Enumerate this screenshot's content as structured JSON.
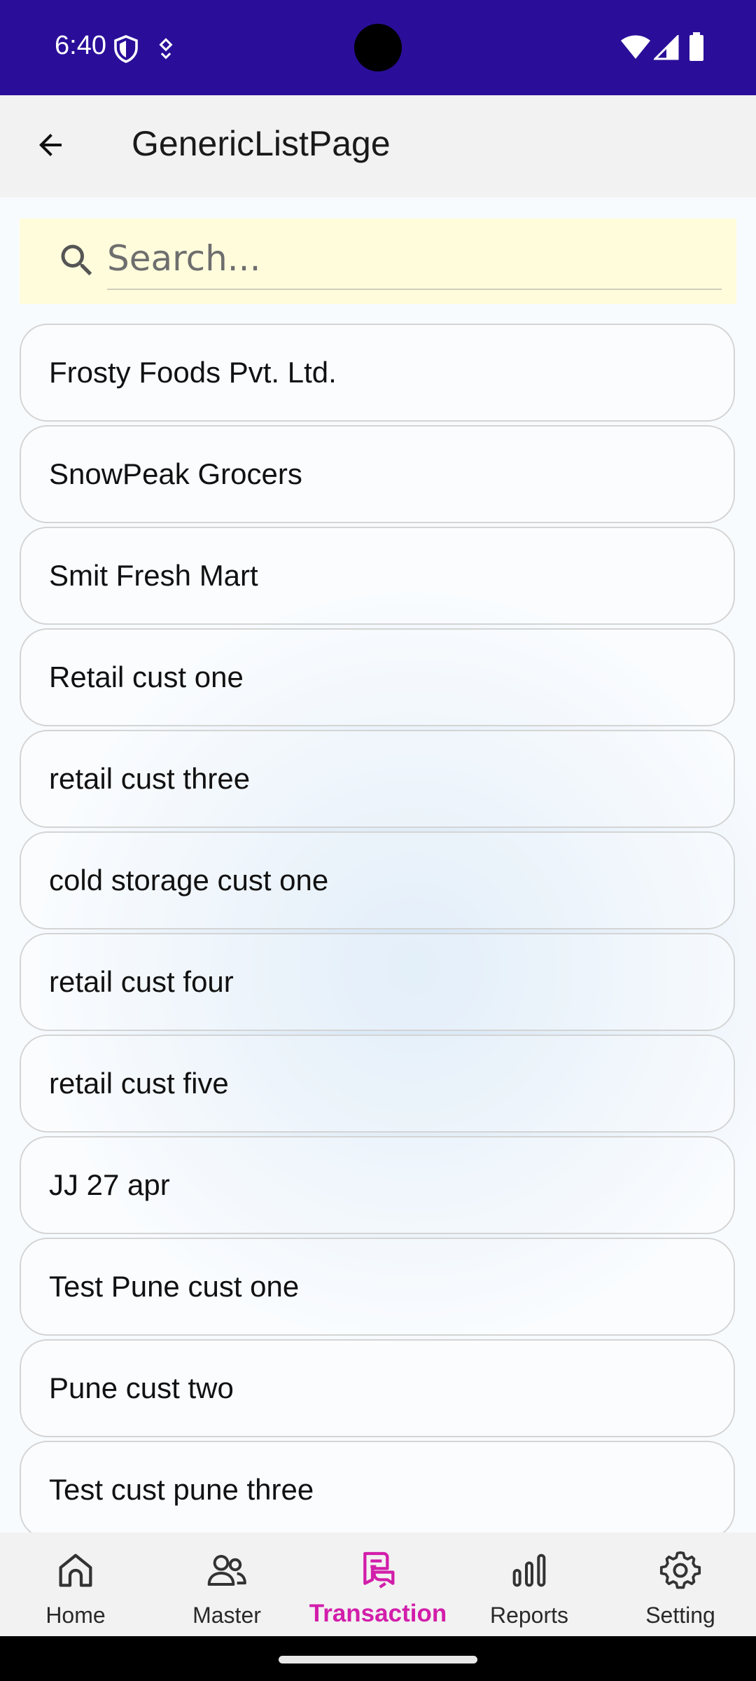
{
  "colors": {
    "status_bar": "#2A0E99",
    "accent": "#D21EAA",
    "search_bg": "#FFFCDC"
  },
  "status_bar": {
    "time": "6:40",
    "icons": [
      "shield-icon",
      "location-pin-icon",
      "wifi-icon",
      "cell-signal-icon",
      "battery-icon"
    ]
  },
  "app_bar": {
    "title": "GenericListPage",
    "back_icon": "arrow-left-icon"
  },
  "search": {
    "placeholder": "Search...",
    "value": ""
  },
  "list": {
    "items": [
      "Frosty Foods Pvt. Ltd.",
      "SnowPeak Grocers",
      "Smit Fresh Mart",
      "Retail cust one",
      "retail cust three",
      "cold storage cust one",
      "retail cust four",
      "retail cust five",
      "JJ 27 apr",
      "Test Pune cust one",
      "Pune cust two",
      "Test cust pune three"
    ]
  },
  "bottom_nav": {
    "items": [
      {
        "label": "Home",
        "icon": "home-icon",
        "active": false
      },
      {
        "label": "Master",
        "icon": "users-icon",
        "active": false
      },
      {
        "label": "Transaction",
        "icon": "transaction-icon",
        "active": true
      },
      {
        "label": "Reports",
        "icon": "bar-chart-icon",
        "active": false
      },
      {
        "label": "Setting",
        "icon": "gear-icon",
        "active": false
      }
    ]
  }
}
